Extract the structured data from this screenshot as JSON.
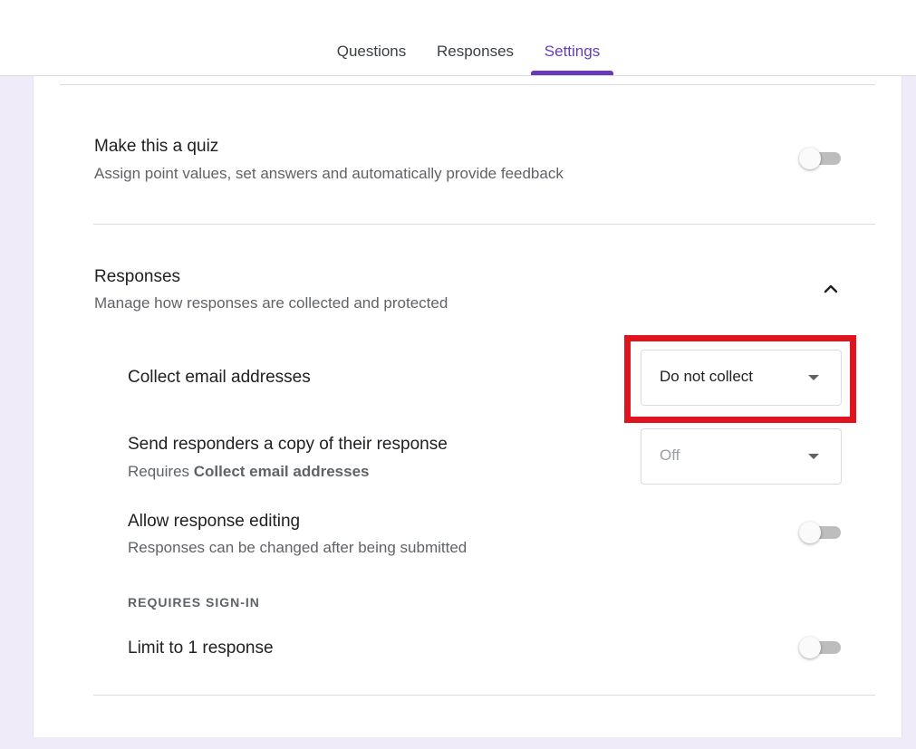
{
  "tabs": [
    {
      "label": "Questions"
    },
    {
      "label": "Responses"
    },
    {
      "label": "Settings",
      "active": true
    }
  ],
  "quiz": {
    "title": "Make this a quiz",
    "description": "Assign point values, set answers and automatically provide feedback",
    "enabled": false
  },
  "responses": {
    "title": "Responses",
    "description": "Manage how responses are collected and protected",
    "expanded": true,
    "collect_email": {
      "label": "Collect email addresses",
      "value": "Do not collect"
    },
    "send_copy": {
      "label": "Send responders a copy of their response",
      "requires_prefix": "Requires ",
      "requires_bold": "Collect email addresses",
      "value": "Off",
      "disabled": true
    },
    "allow_editing": {
      "label": "Allow response editing",
      "description": "Responses can be changed after being submitted",
      "enabled": false
    },
    "requires_signin_heading": "REQUIRES SIGN-IN",
    "limit_one": {
      "label": "Limit to 1 response",
      "enabled": false
    }
  },
  "colors": {
    "accent": "#673ab7",
    "highlight": "#e0141e",
    "background": "#f0ebf8"
  }
}
